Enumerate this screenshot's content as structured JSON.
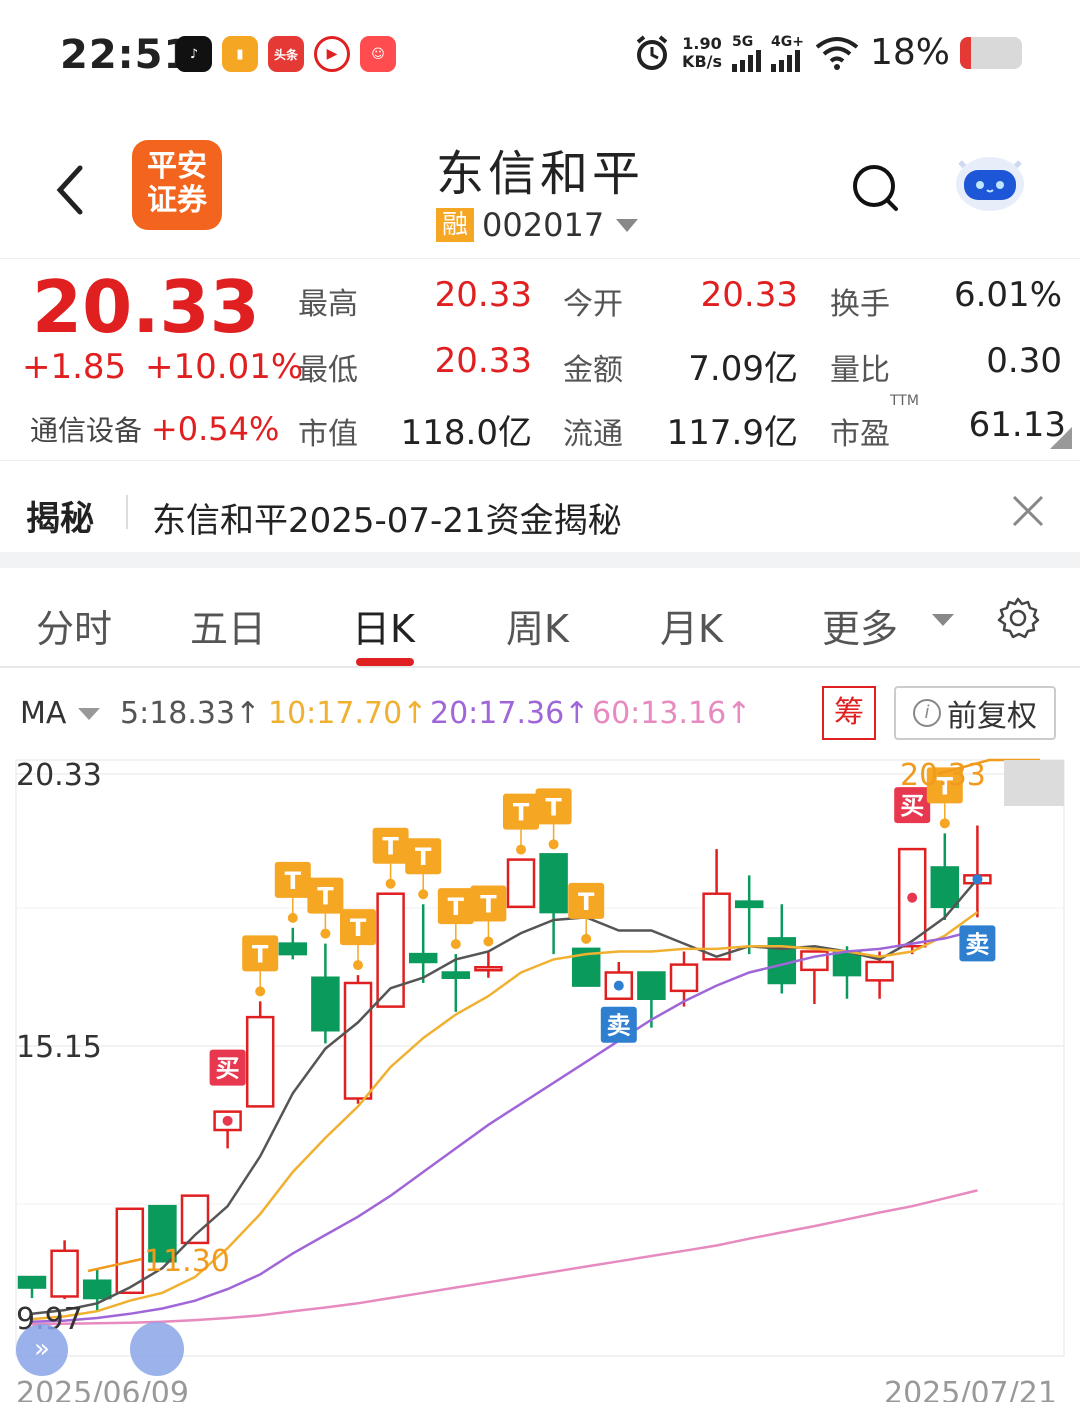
{
  "status_bar": {
    "time": "22:51",
    "net_speed_value": "1.90",
    "net_speed_unit": "KB/s",
    "signal1_label": "5G",
    "signal2_label": "4G+",
    "battery": "18%",
    "battery_level": 0.18,
    "app_icons": [
      "tiktok-icon",
      "notes-icon",
      "toutiao-icon",
      "video-icon",
      "hotel-icon"
    ],
    "toutiao_label": "头条"
  },
  "header": {
    "logo_text_1": "平安",
    "logo_text_2": "证券",
    "stock_name": "东信和平",
    "badge": "融",
    "stock_code": "002017"
  },
  "quote": {
    "price": "20.33",
    "change": "+1.85",
    "change_pct": "+10.01%",
    "sector_name": "通信设备",
    "sector_pct": "+0.54%",
    "high_label": "最高",
    "high": "20.33",
    "open_label": "今开",
    "open": "20.33",
    "turnover_label": "换手",
    "turnover": "6.01%",
    "low_label": "最低",
    "low": "20.33",
    "amount_label": "金额",
    "amount": "7.09亿",
    "vol_ratio_label": "量比",
    "vol_ratio": "0.30",
    "mcap_label": "市值",
    "mcap": "118.0亿",
    "float_label": "流通",
    "float": "117.9亿",
    "pe_label": "市盈",
    "pe_suffix": "TTM",
    "pe": "61.13"
  },
  "reveal": {
    "tag": "揭秘",
    "text": "东信和平2025-07-21资金揭秘"
  },
  "tabs": {
    "items": [
      "分时",
      "五日",
      "日K",
      "周K",
      "月K",
      "更多"
    ],
    "active": "日K"
  },
  "ma": {
    "label": "MA",
    "ma5": "5:18.33↑",
    "ma10": "10:17.70↑",
    "ma20": "20:17.36↑",
    "ma60": "60:13.16↑",
    "chip_label": "筹",
    "adjust_label": "前复权",
    "colors": {
      "ma5": "#555555",
      "ma10": "#f0b030",
      "ma20": "#a066d8",
      "ma60": "#e68ac0",
      "up": "#e02020",
      "down": "#0a9a5c"
    }
  },
  "chart_data": {
    "type": "candlestick",
    "y_labels": [
      "20.33",
      "15.15",
      "9.97"
    ],
    "ylim": [
      9.97,
      20.33
    ],
    "date_start": "2025/06/09",
    "date_end": "2025/07/21",
    "low_annotation": "11.30",
    "high_annotation": "20.33",
    "candles": [
      {
        "o": 10.75,
        "c": 10.55,
        "h": 10.75,
        "l": 10.35
      },
      {
        "o": 10.38,
        "c": 11.25,
        "h": 11.45,
        "l": 10.33
      },
      {
        "o": 10.68,
        "c": 10.35,
        "h": 10.9,
        "l": 10.1
      },
      {
        "o": 10.45,
        "c": 12.05,
        "h": 12.05,
        "l": 10.45
      },
      {
        "o": 12.1,
        "c": 11.05,
        "h": 12.1,
        "l": 11.05
      },
      {
        "o": 11.4,
        "c": 12.3,
        "h": 12.3,
        "l": 11.4
      },
      {
        "o": 13.55,
        "c": 13.9,
        "h": 13.9,
        "l": 13.2
      },
      {
        "o": 14.0,
        "c": 15.7,
        "h": 16.0,
        "l": 14.0
      },
      {
        "o": 17.1,
        "c": 16.9,
        "h": 17.4,
        "l": 16.8
      },
      {
        "o": 16.45,
        "c": 15.45,
        "h": 17.1,
        "l": 15.2
      },
      {
        "o": 14.15,
        "c": 16.35,
        "h": 16.5,
        "l": 14.05
      },
      {
        "o": 15.9,
        "c": 18.05,
        "h": 18.05,
        "l": 15.9
      },
      {
        "o": 16.9,
        "c": 16.75,
        "h": 17.85,
        "l": 16.35
      },
      {
        "o": 16.55,
        "c": 16.45,
        "h": 16.9,
        "l": 15.8
      },
      {
        "o": 16.65,
        "c": 16.65,
        "h": 16.95,
        "l": 16.45
      },
      {
        "o": 17.8,
        "c": 18.7,
        "h": 18.7,
        "l": 17.8
      },
      {
        "o": 18.8,
        "c": 17.7,
        "h": 18.8,
        "l": 16.9
      },
      {
        "o": 17.0,
        "c": 16.3,
        "h": 17.0,
        "l": 16.3
      },
      {
        "o": 16.05,
        "c": 16.55,
        "h": 16.75,
        "l": 16.05
      },
      {
        "o": 16.55,
        "c": 16.05,
        "h": 16.55,
        "l": 15.5
      },
      {
        "o": 16.2,
        "c": 16.7,
        "h": 16.95,
        "l": 15.9
      },
      {
        "o": 16.8,
        "c": 18.05,
        "h": 18.9,
        "l": 16.8
      },
      {
        "o": 17.9,
        "c": 17.8,
        "h": 18.4,
        "l": 16.9
      },
      {
        "o": 17.2,
        "c": 16.35,
        "h": 17.85,
        "l": 16.15
      },
      {
        "o": 16.6,
        "c": 16.95,
        "h": 16.95,
        "l": 15.95
      },
      {
        "o": 16.95,
        "c": 16.5,
        "h": 17.05,
        "l": 16.05
      },
      {
        "o": 16.4,
        "c": 16.75,
        "h": 16.95,
        "l": 16.05
      },
      {
        "o": 17.05,
        "c": 18.9,
        "h": 18.9,
        "l": 16.9
      },
      {
        "o": 18.55,
        "c": 17.8,
        "h": 19.2,
        "l": 17.55
      },
      {
        "o": 18.25,
        "c": 18.4,
        "h": 19.35,
        "l": 17.6
      }
    ],
    "series": [
      {
        "name": "MA5",
        "color": "#555555",
        "points": [
          [
            0,
            10.05
          ],
          [
            1,
            10.12
          ],
          [
            2,
            10.25
          ],
          [
            3,
            10.55
          ],
          [
            4,
            10.92
          ],
          [
            5,
            11.55
          ],
          [
            6,
            12.1
          ],
          [
            7,
            13.05
          ],
          [
            8,
            14.25
          ],
          [
            9,
            15.1
          ],
          [
            10,
            15.6
          ],
          [
            11,
            16.25
          ],
          [
            12,
            16.45
          ],
          [
            13,
            16.8
          ],
          [
            14,
            16.95
          ],
          [
            15,
            17.3
          ],
          [
            16,
            17.55
          ],
          [
            17,
            17.6
          ],
          [
            18,
            17.35
          ],
          [
            19,
            17.35
          ],
          [
            20,
            17.1
          ],
          [
            21,
            16.85
          ],
          [
            22,
            17.05
          ],
          [
            23,
            17.0
          ],
          [
            24,
            17.05
          ],
          [
            25,
            16.95
          ],
          [
            26,
            16.8
          ],
          [
            27,
            17.15
          ],
          [
            28,
            17.6
          ],
          [
            29,
            18.33
          ]
        ]
      },
      {
        "name": "MA10",
        "color": "#f0b030",
        "points": [
          [
            0,
            9.95
          ],
          [
            1,
            10.0
          ],
          [
            2,
            10.1
          ],
          [
            3,
            10.3
          ],
          [
            4,
            10.45
          ],
          [
            5,
            10.75
          ],
          [
            6,
            11.3
          ],
          [
            7,
            11.95
          ],
          [
            8,
            12.75
          ],
          [
            9,
            13.4
          ],
          [
            10,
            14.0
          ],
          [
            11,
            14.75
          ],
          [
            12,
            15.3
          ],
          [
            13,
            15.75
          ],
          [
            14,
            16.1
          ],
          [
            15,
            16.55
          ],
          [
            16,
            16.8
          ],
          [
            17,
            16.9
          ],
          [
            18,
            16.95
          ],
          [
            19,
            16.95
          ],
          [
            20,
            17.0
          ],
          [
            21,
            17.0
          ],
          [
            22,
            17.05
          ],
          [
            23,
            17.05
          ],
          [
            24,
            17.0
          ],
          [
            25,
            16.95
          ],
          [
            26,
            16.85
          ],
          [
            27,
            16.95
          ],
          [
            28,
            17.25
          ],
          [
            29,
            17.7
          ]
        ]
      },
      {
        "name": "MA20",
        "color": "#a066d8",
        "points": [
          [
            0,
            9.9
          ],
          [
            1,
            9.92
          ],
          [
            2,
            9.97
          ],
          [
            3,
            10.05
          ],
          [
            4,
            10.15
          ],
          [
            5,
            10.3
          ],
          [
            6,
            10.52
          ],
          [
            7,
            10.8
          ],
          [
            8,
            11.2
          ],
          [
            9,
            11.55
          ],
          [
            10,
            11.9
          ],
          [
            11,
            12.3
          ],
          [
            12,
            12.75
          ],
          [
            13,
            13.2
          ],
          [
            14,
            13.65
          ],
          [
            15,
            14.05
          ],
          [
            16,
            14.45
          ],
          [
            17,
            14.85
          ],
          [
            18,
            15.25
          ],
          [
            19,
            15.65
          ],
          [
            20,
            16.0
          ],
          [
            21,
            16.3
          ],
          [
            22,
            16.55
          ],
          [
            23,
            16.7
          ],
          [
            24,
            16.85
          ],
          [
            25,
            16.95
          ],
          [
            26,
            17.0
          ],
          [
            27,
            17.1
          ],
          [
            28,
            17.2
          ],
          [
            29,
            17.36
          ]
        ]
      },
      {
        "name": "MA60",
        "color": "#e68ac0",
        "points": [
          [
            0,
            9.85
          ],
          [
            1,
            9.86
          ],
          [
            2,
            9.87
          ],
          [
            3,
            9.88
          ],
          [
            4,
            9.9
          ],
          [
            5,
            9.93
          ],
          [
            6,
            9.97
          ],
          [
            7,
            10.02
          ],
          [
            8,
            10.1
          ],
          [
            9,
            10.17
          ],
          [
            10,
            10.25
          ],
          [
            11,
            10.35
          ],
          [
            12,
            10.45
          ],
          [
            13,
            10.55
          ],
          [
            14,
            10.65
          ],
          [
            15,
            10.75
          ],
          [
            16,
            10.85
          ],
          [
            17,
            10.95
          ],
          [
            18,
            11.05
          ],
          [
            19,
            11.15
          ],
          [
            20,
            11.25
          ],
          [
            21,
            11.35
          ],
          [
            22,
            11.48
          ],
          [
            23,
            11.6
          ],
          [
            24,
            11.72
          ],
          [
            25,
            11.85
          ],
          [
            26,
            11.98
          ],
          [
            27,
            12.1
          ],
          [
            28,
            12.25
          ],
          [
            29,
            12.4
          ]
        ]
      }
    ],
    "signals": [
      {
        "i": 6,
        "kind": "买"
      },
      {
        "i": 7,
        "kind": "T"
      },
      {
        "i": 8,
        "kind": "T"
      },
      {
        "i": 9,
        "kind": "T"
      },
      {
        "i": 10,
        "kind": "T"
      },
      {
        "i": 11,
        "kind": "T"
      },
      {
        "i": 12,
        "kind": "T"
      },
      {
        "i": 13,
        "kind": "T"
      },
      {
        "i": 14,
        "kind": "T"
      },
      {
        "i": 15,
        "kind": "T"
      },
      {
        "i": 16,
        "kind": "T"
      },
      {
        "i": 17,
        "kind": "T"
      },
      {
        "i": 18,
        "kind": "卖"
      },
      {
        "i": 27,
        "kind": "买"
      },
      {
        "i": 28,
        "kind": "T"
      },
      {
        "i": 29,
        "kind": "卖"
      }
    ]
  }
}
